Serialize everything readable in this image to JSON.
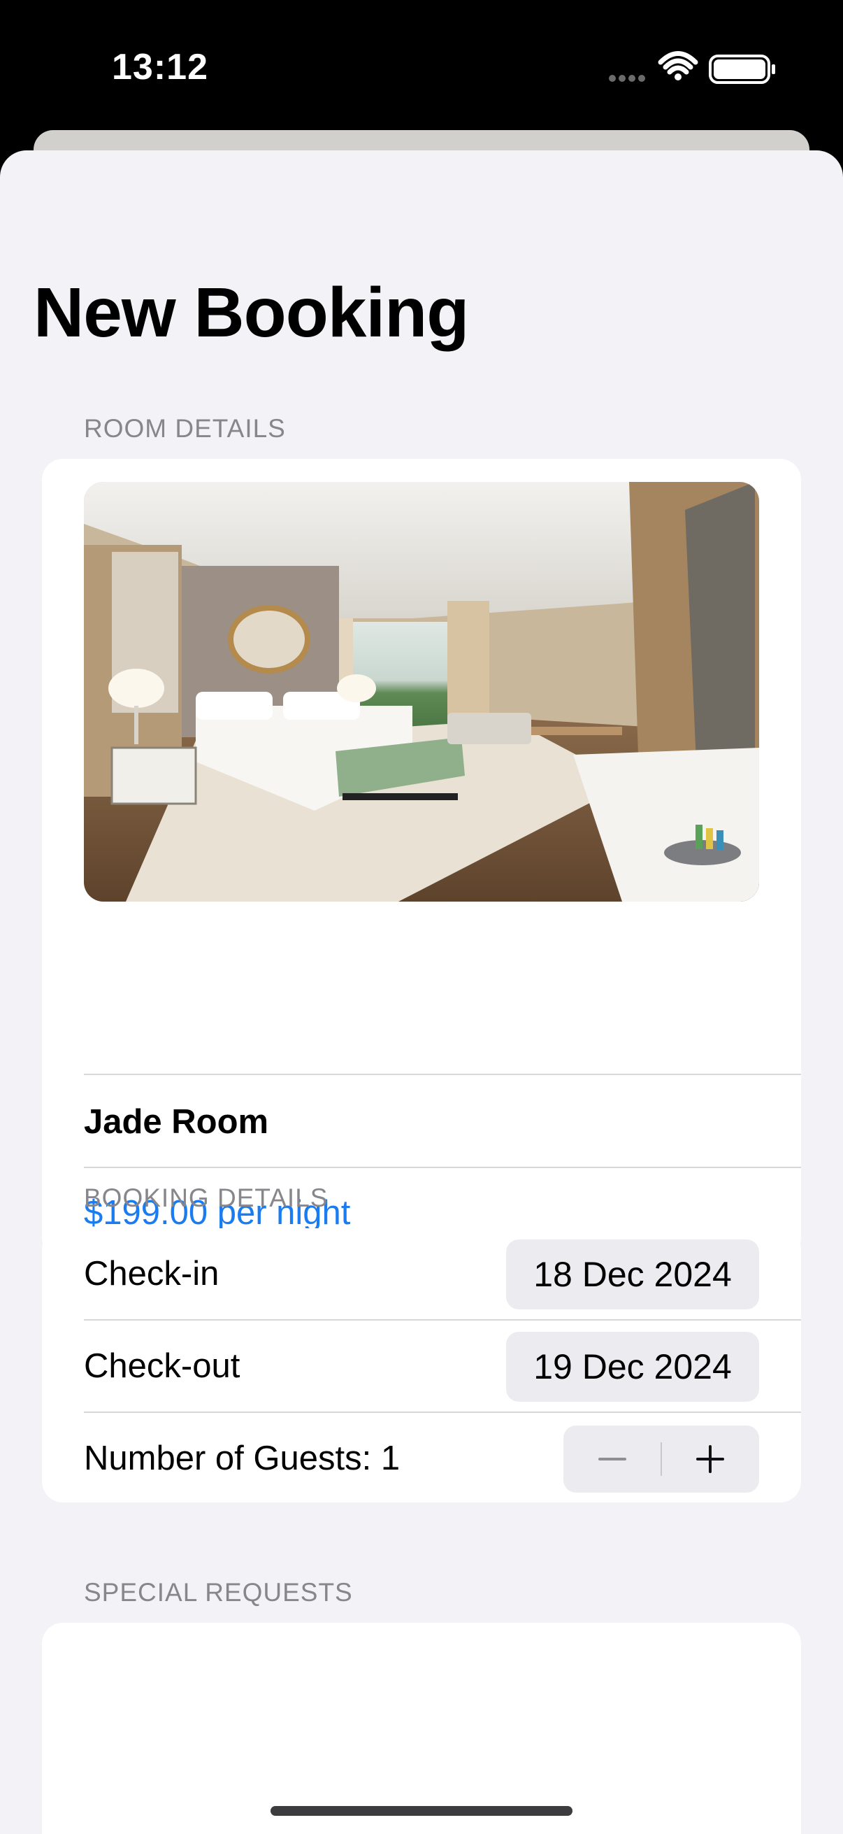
{
  "status_bar": {
    "time": "13:12",
    "icons": [
      "signal-dots-icon",
      "wifi-icon",
      "battery-icon"
    ]
  },
  "page": {
    "title": "New Booking"
  },
  "room_details": {
    "header": "ROOM DETAILS",
    "name": "Jade Room",
    "price": "$199.00 per night",
    "price_color": "#1a7cf0"
  },
  "booking_details": {
    "header": "BOOKING DETAILS",
    "check_in_label": "Check-in",
    "check_in_value": "18 Dec 2024",
    "check_out_label": "Check-out",
    "check_out_value": "19 Dec 2024",
    "guests_label": "Number of Guests: 1",
    "stepper": {
      "decrement_icon": "minus-icon",
      "increment_icon": "plus-icon"
    }
  },
  "special_requests": {
    "header": "SPECIAL REQUESTS",
    "value": ""
  }
}
